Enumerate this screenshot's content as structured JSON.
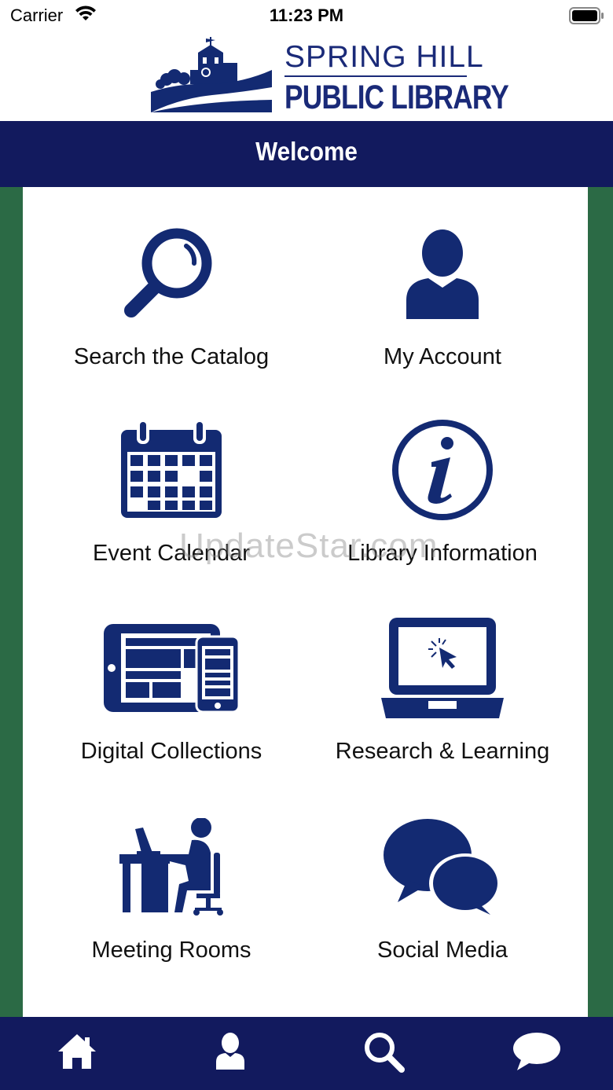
{
  "status_bar": {
    "carrier": "Carrier",
    "time": "11:23 PM"
  },
  "logo": {
    "line1": "SPRING HILL",
    "line2": "PUBLIC LIBRARY"
  },
  "header": {
    "title": "Welcome"
  },
  "menu": [
    {
      "label": "Search the Catalog",
      "icon": "magnifier-icon"
    },
    {
      "label": "My Account",
      "icon": "person-icon"
    },
    {
      "label": "Event Calendar",
      "icon": "calendar-icon"
    },
    {
      "label": "Library Information",
      "icon": "info-icon"
    },
    {
      "label": "Digital Collections",
      "icon": "devices-icon"
    },
    {
      "label": "Research & Learning",
      "icon": "laptop-icon"
    },
    {
      "label": "Meeting Rooms",
      "icon": "desk-person-icon"
    },
    {
      "label": "Social Media",
      "icon": "chat-bubbles-icon"
    }
  ],
  "watermark": "UpdateStar.com",
  "tab_bar": [
    {
      "icon": "home-icon"
    },
    {
      "icon": "person-icon"
    },
    {
      "icon": "search-icon"
    },
    {
      "icon": "chat-icon"
    }
  ],
  "colors": {
    "navy": "#121a5e",
    "icon_blue": "#132a72",
    "green": "#2b6a45"
  }
}
